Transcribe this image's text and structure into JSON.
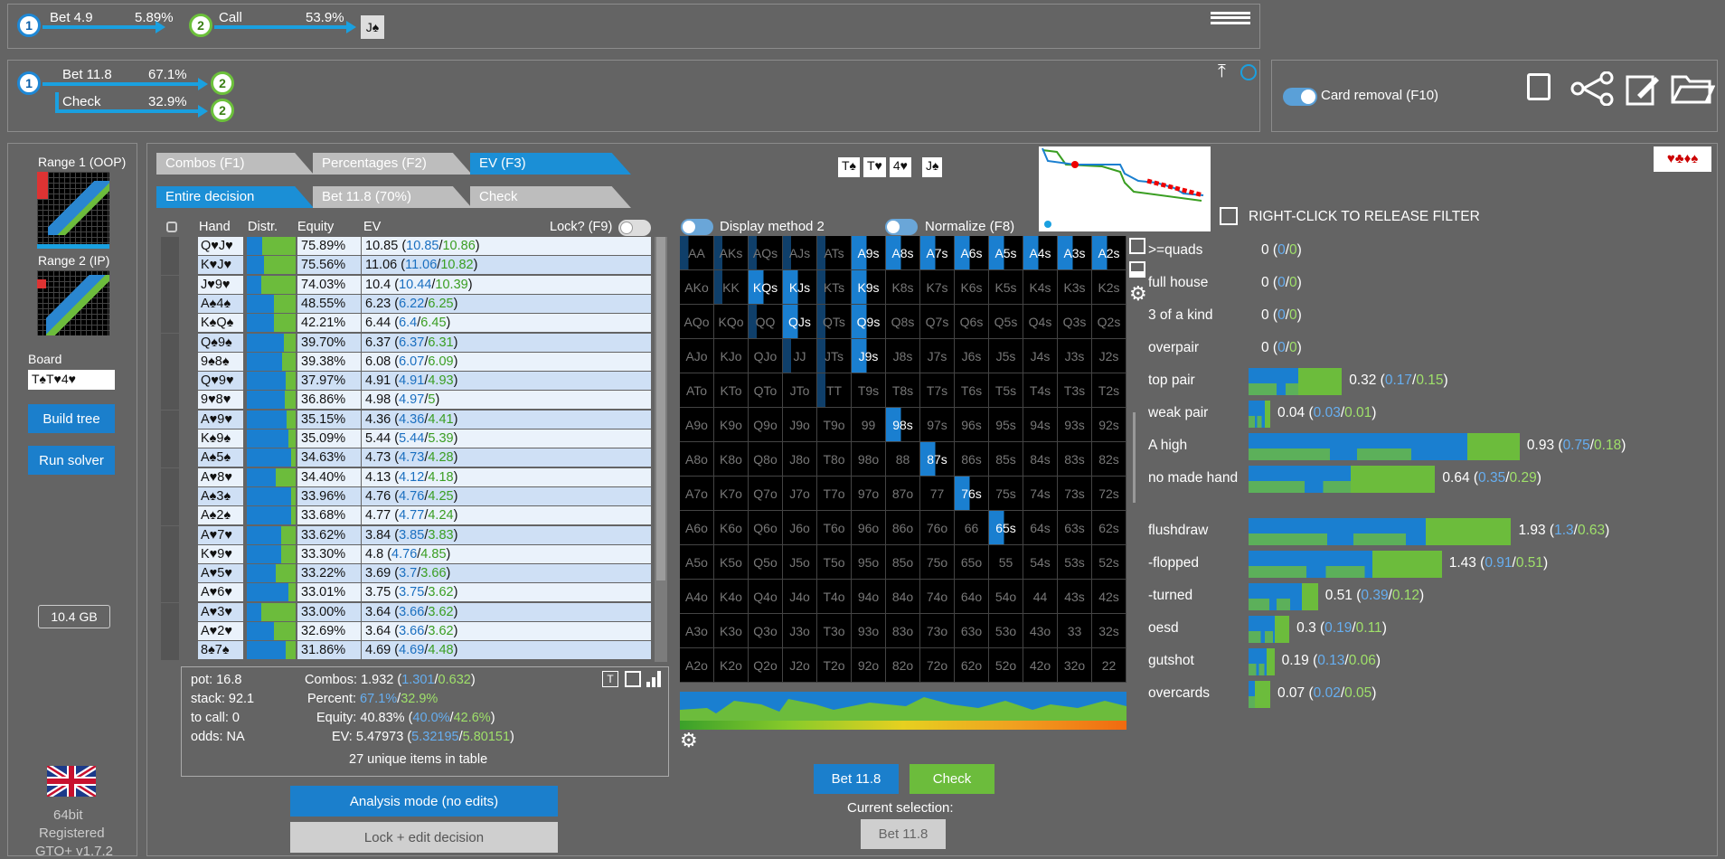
{
  "tree_top": {
    "nodes": [
      "1",
      "2"
    ],
    "action1": {
      "label": "Bet 4.9",
      "pct": "5.89%"
    },
    "action2": {
      "label": "Call",
      "pct": "53.9%"
    },
    "card": "J♠"
  },
  "tree_current": {
    "root": "1",
    "actions": [
      {
        "label": "Bet 11.8",
        "pct": "67.1%",
        "node": "2"
      },
      {
        "label": "Check",
        "pct": "32.9%",
        "node": "2"
      }
    ]
  },
  "card_removal": {
    "label": "Card removal (F10)"
  },
  "left_panel": {
    "range1": "Range 1 (OOP)",
    "range2": "Range 2 (IP)",
    "board_label": "Board",
    "board_value": "T♠T♥4♥",
    "build_tree": "Build tree",
    "run_solver": "Run solver",
    "memory": "10.4 GB",
    "bits": "64bit",
    "registered": "Registered",
    "version": "GTO+ v1.7.2"
  },
  "tabs_top": [
    "Combos (F1)",
    "Percentages (F2)",
    "EV (F3)"
  ],
  "tabs_bottom": [
    "Entire decision",
    "Bet 11.8 (70%)",
    "Check"
  ],
  "board_cards": [
    "T♠",
    "T♥",
    "4♥",
    "J♠"
  ],
  "suits_icon": "♥♣♦♠",
  "filter_hint": "RIGHT-CLICK TO RELEASE FILTER",
  "table": {
    "headers": {
      "hand": "Hand",
      "distr": "Distr.",
      "equity": "Equity",
      "ev": "EV",
      "lock": "Lock? (F9)"
    },
    "rows": [
      {
        "hand": "Q♥J♥",
        "equity": "75.89%",
        "ev": "10.85",
        "ev_a": "10.85",
        "ev_b": "10.86",
        "blue": 0.32
      },
      {
        "hand": "K♥J♥",
        "equity": "75.56%",
        "ev": "11.06",
        "ev_a": "11.06",
        "ev_b": "10.82",
        "blue": 0.35
      },
      {
        "hand": "J♥9♥",
        "equity": "74.03%",
        "ev": "10.4",
        "ev_a": "10.44",
        "ev_b": "10.39",
        "blue": 0.3
      },
      {
        "hand": "A♠4♠",
        "equity": "48.55%",
        "ev": "6.23",
        "ev_a": "6.22",
        "ev_b": "6.25",
        "blue": 0.55
      },
      {
        "hand": "K♠Q♠",
        "equity": "42.21%",
        "ev": "6.44",
        "ev_a": "6.4",
        "ev_b": "6.45",
        "blue": 0.55
      },
      {
        "hand": "Q♠9♠",
        "equity": "39.70%",
        "ev": "6.37",
        "ev_a": "6.37",
        "ev_b": "6.31",
        "blue": 0.75
      },
      {
        "hand": "9♠8♠",
        "equity": "39.38%",
        "ev": "6.08",
        "ev_a": "6.07",
        "ev_b": "6.09",
        "blue": 0.72
      },
      {
        "hand": "Q♥9♥",
        "equity": "37.97%",
        "ev": "4.91",
        "ev_a": "4.91",
        "ev_b": "4.93",
        "blue": 0.8
      },
      {
        "hand": "9♥8♥",
        "equity": "36.86%",
        "ev": "4.98",
        "ev_a": "4.97",
        "ev_b": "5",
        "blue": 0.78
      },
      {
        "hand": "A♥9♥",
        "equity": "35.15%",
        "ev": "4.36",
        "ev_a": "4.36",
        "ev_b": "4.41",
        "blue": 0.82
      },
      {
        "hand": "K♠9♠",
        "equity": "35.09%",
        "ev": "5.44",
        "ev_a": "5.44",
        "ev_b": "5.39",
        "blue": 0.85
      },
      {
        "hand": "A♠5♠",
        "equity": "34.63%",
        "ev": "4.73",
        "ev_a": "4.73",
        "ev_b": "4.28",
        "blue": 0.9
      },
      {
        "hand": "A♥8♥",
        "equity": "34.40%",
        "ev": "4.13",
        "ev_a": "4.12",
        "ev_b": "4.18",
        "blue": 0.6
      },
      {
        "hand": "A♠3♠",
        "equity": "33.96%",
        "ev": "4.76",
        "ev_a": "4.76",
        "ev_b": "4.25",
        "blue": 0.9
      },
      {
        "hand": "A♠2♠",
        "equity": "33.68%",
        "ev": "4.77",
        "ev_a": "4.77",
        "ev_b": "4.24",
        "blue": 0.9
      },
      {
        "hand": "A♥7♥",
        "equity": "33.62%",
        "ev": "3.84",
        "ev_a": "3.85",
        "ev_b": "3.83",
        "blue": 0.7
      },
      {
        "hand": "K♥9♥",
        "equity": "33.30%",
        "ev": "4.8",
        "ev_a": "4.76",
        "ev_b": "4.85",
        "blue": 0.7
      },
      {
        "hand": "A♥5♥",
        "equity": "33.22%",
        "ev": "3.69",
        "ev_a": "3.7",
        "ev_b": "3.66",
        "blue": 0.6
      },
      {
        "hand": "A♥6♥",
        "equity": "33.01%",
        "ev": "3.75",
        "ev_a": "3.75",
        "ev_b": "3.62",
        "blue": 0.85
      },
      {
        "hand": "A♥3♥",
        "equity": "33.00%",
        "ev": "3.64",
        "ev_a": "3.66",
        "ev_b": "3.62",
        "blue": 0.3
      },
      {
        "hand": "A♥2♥",
        "equity": "32.69%",
        "ev": "3.64",
        "ev_a": "3.66",
        "ev_b": "3.62",
        "blue": 0.55
      },
      {
        "hand": "8♠7♠",
        "equity": "31.86%",
        "ev": "4.69",
        "ev_a": "4.69",
        "ev_b": "4.48",
        "blue": 0.8
      }
    ]
  },
  "summary": {
    "pot": "pot: 16.8",
    "stack": "stack: 92.1",
    "to_call": "to call: 0",
    "odds": "odds: NA",
    "combos_label": "Combos:",
    "combos": "1.932",
    "combos_a": "1.301",
    "combos_b": "0.632",
    "percent_label": "Percent:",
    "percent_a": "67.1%",
    "percent_b": "32.9%",
    "equity_label": "Equity:",
    "equity": "40.83%",
    "equity_a": "40.0%",
    "equity_b": "42.6%",
    "ev_label": "EV:",
    "ev": "5.47973",
    "ev_a": "5.32195",
    "ev_b": "5.80151",
    "unique": "27 unique items in table"
  },
  "analysis_mode": "Analysis mode (no edits)",
  "lock_edit": "Lock + edit decision",
  "display_method": "Display method 2",
  "normalize": "Normalize (F8)",
  "grid_ranks": [
    "A",
    "K",
    "Q",
    "J",
    "T",
    "9",
    "8",
    "7",
    "6",
    "5",
    "4",
    "3",
    "2"
  ],
  "action_buttons": {
    "bet": "Bet 11.8",
    "check": "Check"
  },
  "current_selection_label": "Current selection:",
  "current_selection": "Bet 11.8",
  "stats": [
    {
      "label": ">=quads",
      "val": "0",
      "a": "0",
      "b": "0",
      "blue": 0,
      "green": 0
    },
    {
      "label": "full house",
      "val": "0",
      "a": "0",
      "b": "0",
      "blue": 0,
      "green": 0
    },
    {
      "label": "3 of a kind",
      "val": "0",
      "a": "0",
      "b": "0",
      "blue": 0,
      "green": 0
    },
    {
      "label": "overpair",
      "val": "0",
      "a": "0",
      "b": "0",
      "blue": 0,
      "green": 0
    },
    {
      "label": "top pair",
      "val": "0.32",
      "a": "0.17",
      "b": "0.15",
      "blue": 0.17,
      "green": 0.15
    },
    {
      "label": "weak pair",
      "val": "0.04",
      "a": "0.03",
      "b": "0.01",
      "blue": 0.03,
      "green": 0.01
    },
    {
      "label": "A high",
      "val": "0.93",
      "a": "0.75",
      "b": "0.18",
      "blue": 0.75,
      "green": 0.18
    },
    {
      "label": "no made hand",
      "val": "0.64",
      "a": "0.35",
      "b": "0.29",
      "blue": 0.35,
      "green": 0.29
    },
    {
      "label": "flushdraw",
      "val": "1.93",
      "a": "1.3",
      "b": "0.63",
      "blue": 1.3,
      "green": 0.63
    },
    {
      "label": "-flopped",
      "val": "1.43",
      "a": "0.91",
      "b": "0.51",
      "blue": 0.91,
      "green": 0.51
    },
    {
      "label": "-turned",
      "val": "0.51",
      "a": "0.39",
      "b": "0.12",
      "blue": 0.39,
      "green": 0.12
    },
    {
      "label": "oesd",
      "val": "0.3",
      "a": "0.19",
      "b": "0.11",
      "blue": 0.19,
      "green": 0.11
    },
    {
      "label": "gutshot",
      "val": "0.19",
      "a": "0.13",
      "b": "0.06",
      "blue": 0.13,
      "green": 0.06
    },
    {
      "label": "overcards",
      "val": "0.07",
      "a": "0.02",
      "b": "0.05",
      "blue": 0.02,
      "green": 0.05
    }
  ]
}
